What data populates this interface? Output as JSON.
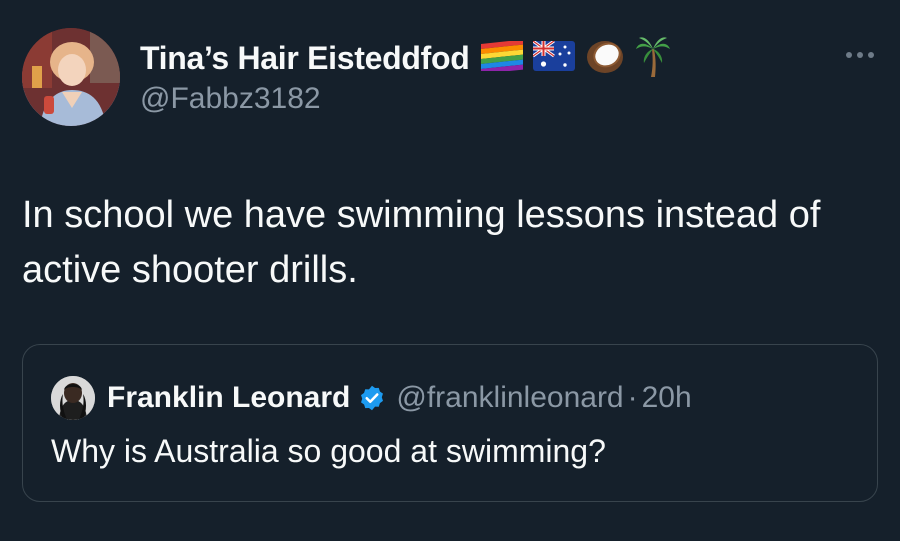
{
  "author": {
    "display_name": "Tina’s Hair Eisteddfod",
    "handle": "@Fabbz3182",
    "name_emojis": [
      "rainbow-flag-icon",
      "australia-flag-icon",
      "coconut-icon",
      "palm-tree-icon"
    ]
  },
  "tweet": {
    "text": "In school we have swimming lessons instead of active shooter drills."
  },
  "quoted_tweet": {
    "display_name": "Franklin Leonard",
    "verified": true,
    "handle": "@franklinleonard",
    "separator": "·",
    "time": "20h",
    "text": "Why is Australia so good at swimming?"
  },
  "colors": {
    "background": "#15202b",
    "primary_text": "#f7f9f9",
    "secondary_text": "#8b98a5",
    "border": "#38444d",
    "verified_blue": "#1d9bf0"
  }
}
